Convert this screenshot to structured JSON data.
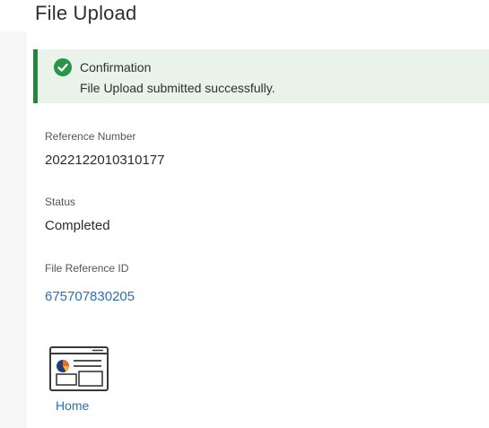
{
  "page": {
    "title": "File Upload"
  },
  "confirmation": {
    "title": "Confirmation",
    "message": "File Upload submitted successfully.",
    "icon": "check-circle-icon",
    "accent_color": "#1e8a3c",
    "background_color": "#e9f3ea"
  },
  "fields": {
    "reference_number": {
      "label": "Reference Number",
      "value": "2022122010310177"
    },
    "status": {
      "label": "Status",
      "value": "Completed"
    },
    "file_reference_id": {
      "label": "File Reference ID",
      "value": "675707830205",
      "link_color": "#2f6fb3"
    }
  },
  "home": {
    "label": "Home",
    "icon": "dashboard-icon"
  }
}
